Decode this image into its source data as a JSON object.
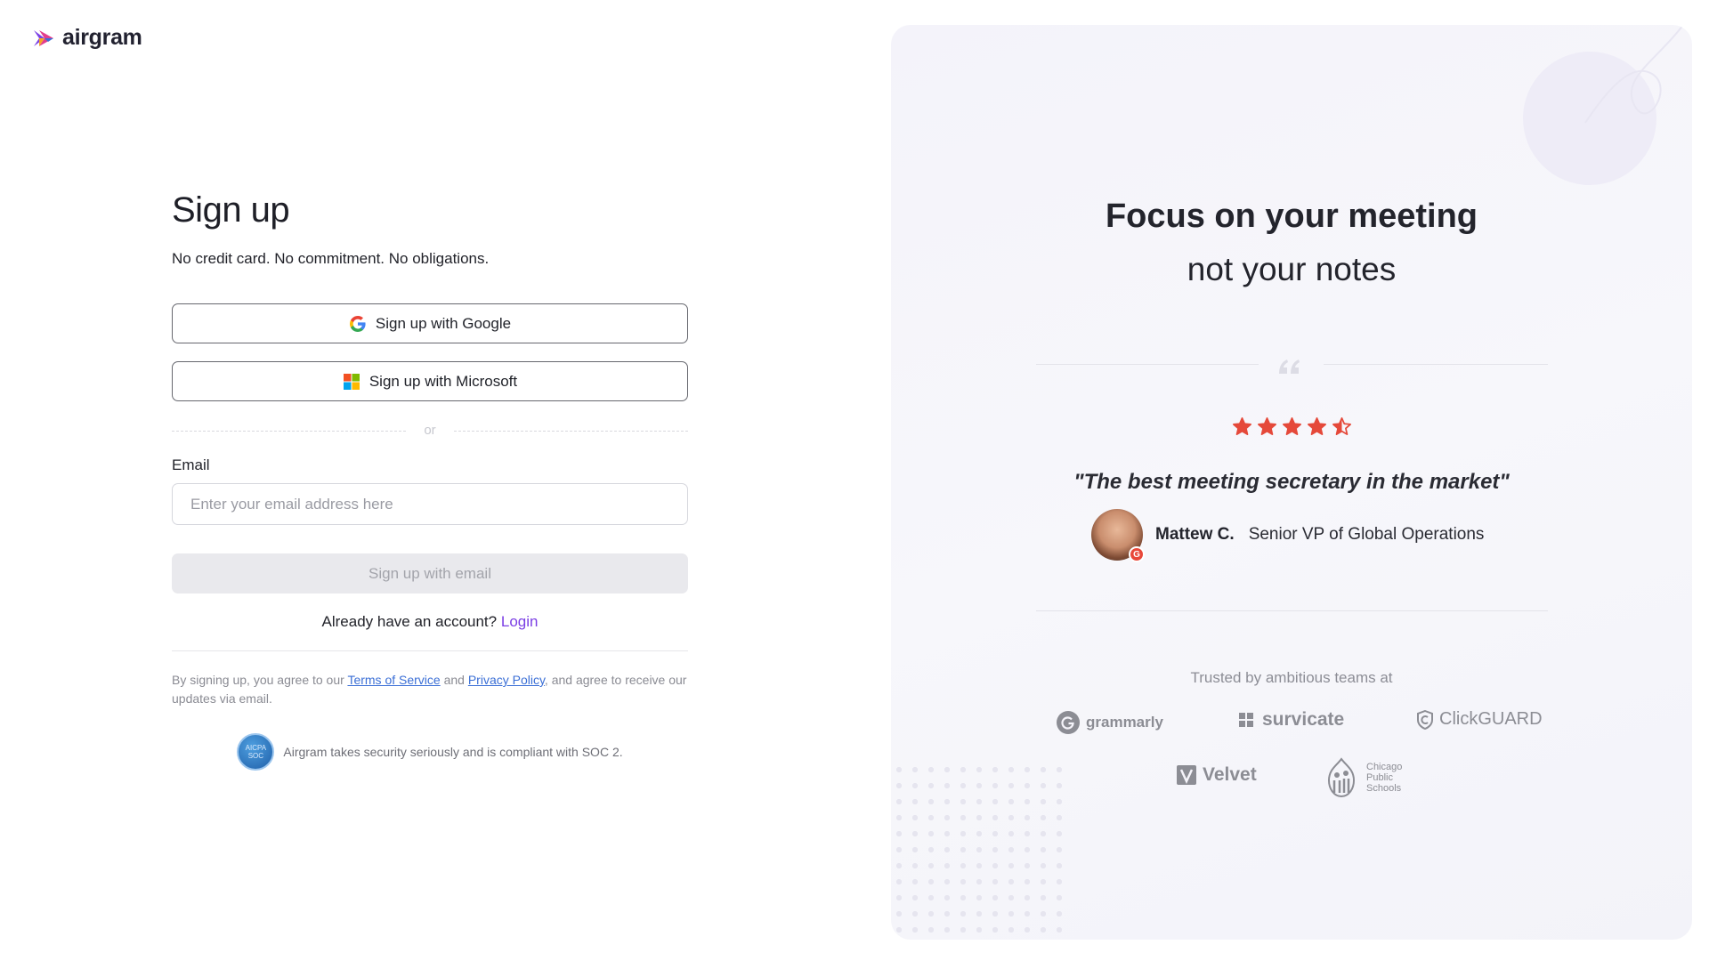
{
  "brand": {
    "name": "airgram"
  },
  "signup": {
    "title": "Sign up",
    "subtitle": "No credit card. No commitment. No obligations.",
    "google_label": "Sign up with Google",
    "microsoft_label": "Sign up with Microsoft",
    "divider_text": "or",
    "email_label": "Email",
    "email_placeholder": "Enter your email address here",
    "email_value": "",
    "email_button": "Sign up with email",
    "already_text": "Already have an account?",
    "login_link": "Login",
    "legal_prefix": "By signing up, you agree to our",
    "terms_link": "Terms of Service",
    "legal_and": "and",
    "privacy_link": "Privacy Policy",
    "legal_suffix": ", and agree to receive our updates via email.",
    "soc_badge": "AICPA SOC",
    "soc_text": "Airgram takes security seriously and is compliant with SOC 2."
  },
  "promo": {
    "heading": "Focus on your meeting",
    "subheading": "not your notes",
    "rating": 4.5,
    "quote": "\"The best meeting secretary in the market\"",
    "author_name": "Mattew C.",
    "author_role": "Senior VP of Global Operations",
    "trusted_text": "Trusted by ambitious teams at",
    "logos": {
      "grammarly": "grammarly",
      "survicate": "survicate",
      "clickguard": "ClickGUARD",
      "velvet": "Velvet",
      "chicago": "Chicago Public Schools"
    }
  },
  "colors": {
    "accent": "#7b3fe4",
    "link": "#3b6fd6",
    "star": "#e5493a",
    "panel_bg": "#f5f4fa"
  }
}
